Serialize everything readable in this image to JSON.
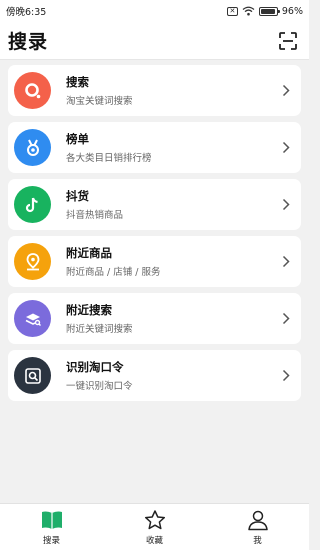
{
  "status_bar": {
    "time": "傍晚6:35",
    "battery_text": "96%",
    "battery_level": 0.96
  },
  "header": {
    "title": "搜录",
    "scan_icon": "scan-icon"
  },
  "menu_items": [
    {
      "title": "搜索",
      "subtitle": "淘宝关键词搜索",
      "icon": "search-icon",
      "color": "#f4614a"
    },
    {
      "title": "榜单",
      "subtitle": "各大类目日销排行榜",
      "icon": "medal-icon",
      "color": "#2f8cf0"
    },
    {
      "title": "抖货",
      "subtitle": "抖音热销商品",
      "icon": "tiktok-icon",
      "color": "#18b35f"
    },
    {
      "title": "附近商品",
      "subtitle": "附近商品 / 店铺 / 服务",
      "icon": "location-pin-icon",
      "color": "#f5a20c"
    },
    {
      "title": "附近搜索",
      "subtitle": "附近关键词搜索",
      "icon": "layers-search-icon",
      "color": "#7b6bdc"
    },
    {
      "title": "识别淘口令",
      "subtitle": "一键识别淘口令",
      "icon": "scan-search-icon",
      "color": "#2b3440"
    }
  ],
  "tab_bar": {
    "tabs": [
      {
        "label": "搜录",
        "icon": "book-icon",
        "active": true,
        "color": "#1fae6a"
      },
      {
        "label": "收藏",
        "icon": "star-icon",
        "active": false
      },
      {
        "label": "我",
        "icon": "person-icon",
        "active": false
      }
    ]
  }
}
